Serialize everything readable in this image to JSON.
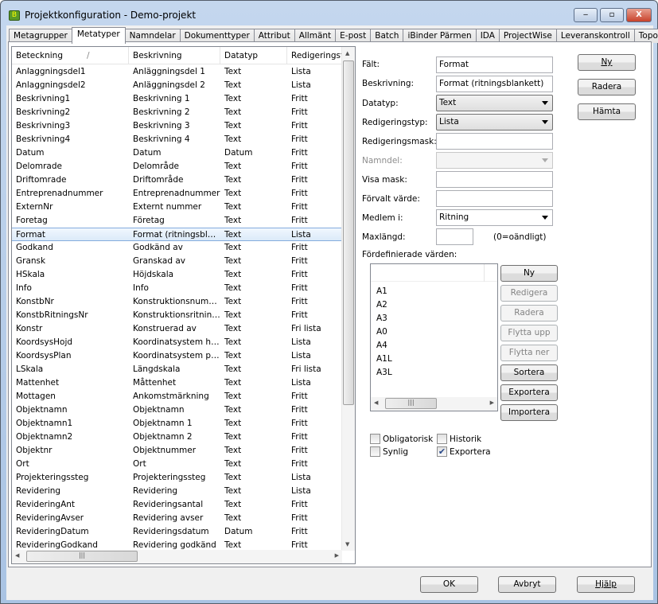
{
  "window": {
    "title": "Projektkonfiguration - Demo-projekt",
    "minimize": "‒",
    "maximize": "▫",
    "close": "X"
  },
  "tabs": [
    "Metagrupper",
    "Metatyper",
    "Namndelar",
    "Dokumenttyper",
    "Attribut",
    "Allmänt",
    "E-post",
    "Batch",
    "iBinder Pärmen",
    "IDA",
    "ProjectWise",
    "Leveranskontroll",
    "Topocad"
  ],
  "active_tab": "Metatyper",
  "table": {
    "columns": [
      "Beteckning",
      "Beskrivning",
      "Datatyp",
      "Redigeringst"
    ],
    "sort_indicator": "/",
    "selected": "Format",
    "rows": [
      [
        "Anlaggningsdel1",
        "Anläggningsdel 1",
        "Text",
        "Lista"
      ],
      [
        "Anlaggningsdel2",
        "Anläggningsdel 2",
        "Text",
        "Lista"
      ],
      [
        "Beskrivning1",
        "Beskrivning 1",
        "Text",
        "Fritt"
      ],
      [
        "Beskrivning2",
        "Beskrivning 2",
        "Text",
        "Fritt"
      ],
      [
        "Beskrivning3",
        "Beskrivning 3",
        "Text",
        "Fritt"
      ],
      [
        "Beskrivning4",
        "Beskrivning 4",
        "Text",
        "Fritt"
      ],
      [
        "Datum",
        "Datum",
        "Datum",
        "Fritt"
      ],
      [
        "Delomrade",
        "Delområde",
        "Text",
        "Fritt"
      ],
      [
        "Driftomrade",
        "Driftområde",
        "Text",
        "Fritt"
      ],
      [
        "Entreprenadnummer",
        "Entreprenadnummer",
        "Text",
        "Fritt"
      ],
      [
        "ExternNr",
        "Externt nummer",
        "Text",
        "Fritt"
      ],
      [
        "Foretag",
        "Företag",
        "Text",
        "Fritt"
      ],
      [
        "Format",
        "Format (ritningsbl…",
        "Text",
        "Lista"
      ],
      [
        "Godkand",
        "Godkänd av",
        "Text",
        "Fritt"
      ],
      [
        "Gransk",
        "Granskad av",
        "Text",
        "Fritt"
      ],
      [
        "HSkala",
        "Höjdskala",
        "Text",
        "Fritt"
      ],
      [
        "Info",
        "Info",
        "Text",
        "Fritt"
      ],
      [
        "KonstbNr",
        "Konstruktionsnum…",
        "Text",
        "Fritt"
      ],
      [
        "KonstbRitningsNr",
        "Konstruktionsritnin…",
        "Text",
        "Fritt"
      ],
      [
        "Konstr",
        "Konstruerad av",
        "Text",
        "Fri lista"
      ],
      [
        "KoordsysHojd",
        "Koordinatsystem h…",
        "Text",
        "Lista"
      ],
      [
        "KoordsysPlan",
        "Koordinatsystem p…",
        "Text",
        "Lista"
      ],
      [
        "LSkala",
        "Längdskala",
        "Text",
        "Fri lista"
      ],
      [
        "Mattenhet",
        "Måttenhet",
        "Text",
        "Lista"
      ],
      [
        "Mottagen",
        "Ankomstmärkning",
        "Text",
        "Fritt"
      ],
      [
        "Objektnamn",
        "Objektnamn",
        "Text",
        "Fritt"
      ],
      [
        "Objektnamn1",
        "Objektnamn 1",
        "Text",
        "Fritt"
      ],
      [
        "Objektnamn2",
        "Objektnamn 2",
        "Text",
        "Fritt"
      ],
      [
        "Objektnr",
        "Objektnummer",
        "Text",
        "Fritt"
      ],
      [
        "Ort",
        "Ort",
        "Text",
        "Fritt"
      ],
      [
        "Projekteringssteg",
        "Projekteringssteg",
        "Text",
        "Lista"
      ],
      [
        "Revidering",
        "Revidering",
        "Text",
        "Lista"
      ],
      [
        "RevideringAnt",
        "Revideringsantal",
        "Text",
        "Fritt"
      ],
      [
        "RevideringAvser",
        "Revidering avser",
        "Text",
        "Fritt"
      ],
      [
        "RevideringDatum",
        "Revideringsdatum",
        "Datum",
        "Fritt"
      ],
      [
        "RevideringGodkand",
        "Revidering godkänd",
        "Text",
        "Fritt"
      ]
    ]
  },
  "form": {
    "falt": {
      "label": "Fält:",
      "value": "Format"
    },
    "beskrivning": {
      "label": "Beskrivning:",
      "value": "Format (ritningsblankett)"
    },
    "datatyp": {
      "label": "Datatyp:",
      "value": "Text"
    },
    "redigeringstyp": {
      "label": "Redigeringstyp:",
      "value": "Lista"
    },
    "redigeringsmask": {
      "label": "Redigeringsmask:",
      "value": ""
    },
    "namndel": {
      "label": "Namndel:",
      "value": ""
    },
    "visa_mask": {
      "label": "Visa mask:",
      "value": ""
    },
    "forvalt": {
      "label": "Förvalt värde:",
      "value": ""
    },
    "medlem": {
      "label": "Medlem i:",
      "value": "Ritning"
    },
    "maxlangd": {
      "label": "Maxlängd:",
      "value": "",
      "hint": "(0=oändligt)"
    },
    "predef_label": "Fördefinierade värden:",
    "predef_values": [
      "A1",
      "A2",
      "A3",
      "A0",
      "A4",
      "A1L",
      "A3L"
    ],
    "obligatorisk": {
      "label": "Obligatorisk",
      "checked": false
    },
    "historik": {
      "label": "Historik",
      "checked": false
    },
    "synlig": {
      "label": "Synlig",
      "checked": false
    },
    "exportera": {
      "label": "Exportera",
      "checked": true
    }
  },
  "side_buttons": {
    "ny": "Ny",
    "radera": "Radera",
    "hamta": "Hämta"
  },
  "predef_buttons": {
    "ny": "Ny",
    "redigera": "Redigera",
    "radera": "Radera",
    "flytta_upp": "Flytta upp",
    "flytta_ner": "Flytta ner",
    "sortera": "Sortera",
    "exportera": "Exportera",
    "importera": "Importera"
  },
  "footer": {
    "ok": "OK",
    "avbryt": "Avbryt",
    "hjalp": "Hjälp"
  }
}
